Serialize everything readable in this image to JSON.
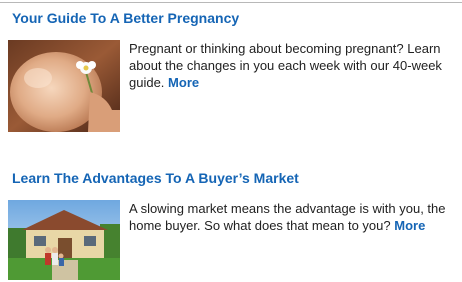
{
  "articles": [
    {
      "title": "Your Guide To A Better Pregnancy",
      "description": "Pregnant or thinking about becoming pregnant? Learn about the changes in you each week with our 40-week guide.",
      "more_label": "More",
      "image_icon": "pregnant-belly-photo"
    },
    {
      "title": "Learn The Advantages To A Buyer’s Market",
      "description": "A slowing market means the advantage is with you, the home buyer. So what does that mean to you?",
      "more_label": "More",
      "image_icon": "family-house-photo"
    }
  ],
  "colors": {
    "link": "#1565b5",
    "text": "#222222",
    "rule": "#b8b8b8"
  }
}
